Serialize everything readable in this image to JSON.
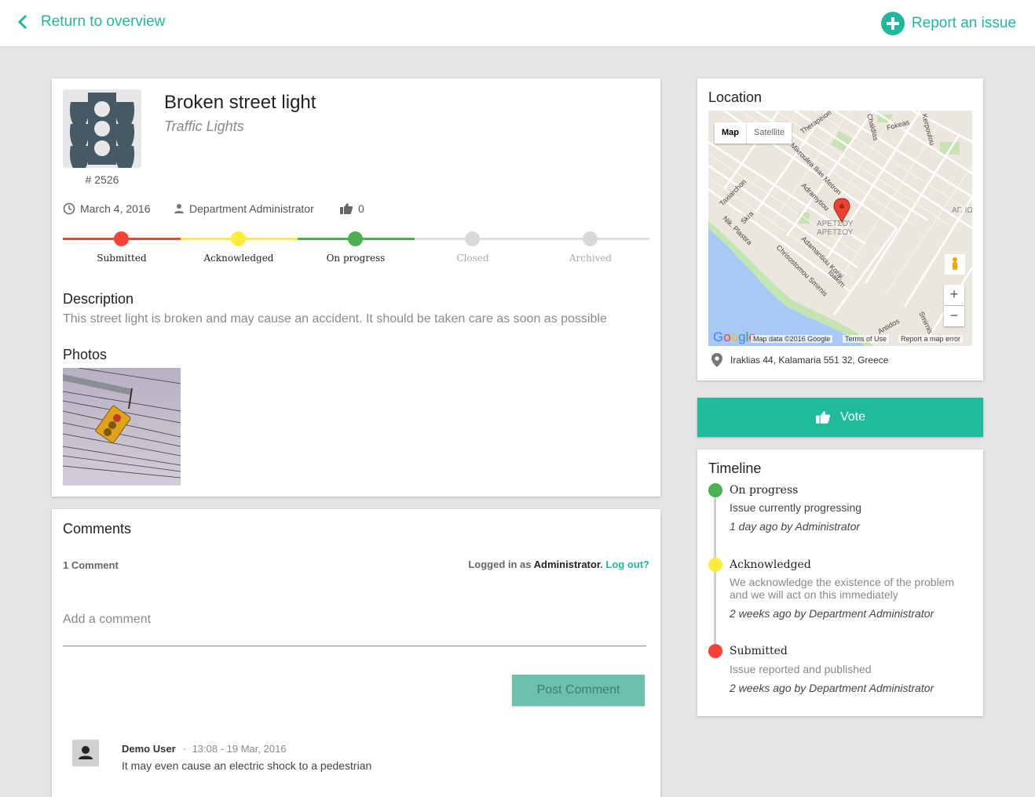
{
  "topbar": {
    "back_label": "Return to overview",
    "report_label": "Report an issue",
    "accent": "#1fb89a"
  },
  "issue": {
    "title": "Broken street light",
    "category": "Traffic Lights",
    "category_icon": "traffic-light-icon",
    "number": "# 2526",
    "date": "March 4, 2016",
    "department": "Department Administrator",
    "votes": "0",
    "progress": [
      {
        "label": "Submitted",
        "color": "#f44336",
        "active": true
      },
      {
        "label": "Acknowledged",
        "color": "#ffeb3b",
        "active": true
      },
      {
        "label": "On progress",
        "color": "#4caf50",
        "active": true
      },
      {
        "label": "Closed",
        "color": "#d9d9d9",
        "active": false
      },
      {
        "label": "Archived",
        "color": "#d9d9d9",
        "active": false
      }
    ],
    "description_heading": "Description",
    "description": "This street light is broken and may cause an accident. It should be taken care as soon as possible",
    "photos_heading": "Photos"
  },
  "comments": {
    "heading": "Comments",
    "count_label": "1 Comment",
    "logged_prefix": "Logged in as ",
    "logged_user": "Administrator",
    "logout_label": "Log out?",
    "placeholder": "Add a comment",
    "post_label": "Post Comment",
    "items": [
      {
        "author": "Demo User",
        "time": "13:08 - 19 Mar, 2016",
        "text": "It may even cause an electric shock to a pedestrian"
      }
    ]
  },
  "location": {
    "heading": "Location",
    "map_label": "Map",
    "satellite_label": "Satellite",
    "map_credit": "Map data ©2016 Google",
    "terms": "Terms of Use",
    "report_error": "Report a map error",
    "address": "Iraklias 44, Kalamaria 551 32, Greece",
    "streets": [
      "Therapeion",
      "Fokeas",
      "Chaldias",
      "Kerpoulou",
      "Mikroulea Ilias",
      "Metron",
      "Adramytiou",
      "Taxiarchon",
      "Skra",
      "Nik. Plastira",
      "Chrisostomou Smirnis",
      "Adamantiou Korai",
      "Ioakim",
      "Smirnis",
      "Antidos",
      "ΑΡΕΤΣΟΥ",
      "ΑΓ. ΙΩ"
    ]
  },
  "vote": {
    "label": "Vote"
  },
  "timeline": {
    "heading": "Timeline",
    "events": [
      {
        "status": "On progress",
        "description": "Issue currently progressing",
        "meta": "1 day ago by Administrator",
        "color": "#4caf50"
      },
      {
        "status": "Acknowledged",
        "description": "We acknowledge the existence of the problem and we will act on this immediately",
        "meta": "2 weeks ago by Department Administrator",
        "color": "#ffeb3b"
      },
      {
        "status": "Submitted",
        "description": "Issue reported and published",
        "meta": "2 weeks ago by Department Administrator",
        "color": "#f44336"
      }
    ]
  }
}
